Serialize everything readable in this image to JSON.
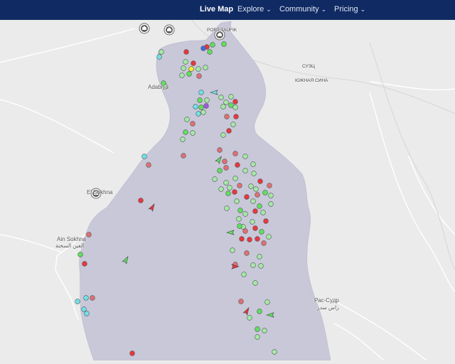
{
  "nav": {
    "live_map": "Live Map",
    "explore": "Explore",
    "community": "Community",
    "pricing": "Pricing",
    "chevron": "⌄"
  },
  "labels": {
    "port_tewfik": "PORT TAUFIK",
    "adabiya": "Adabiya",
    "el_sukhna": "El Sokhna",
    "ain_sokhna": "Ain Sokhna",
    "ain_sokhna_ar": "العين السخنة",
    "suez_ru": "СУЭЦ",
    "south_sinai_ru": "ЮЖНАЯ СИНА",
    "ras_sudr_ru": "Рас-Судр",
    "ras_sudr_ar": "راس سدر"
  },
  "colors": {
    "navbar": "#102a63",
    "water": "#c8c8d9",
    "land": "#ebebeb",
    "red": "#e8373e",
    "pink": "#df7074",
    "green": "#5ee05e",
    "lightgreen": "#a4e8a4",
    "cyan": "#6fe0e6",
    "yellow": "#f0f020",
    "purple": "#a05cd8",
    "blue": "#3c6cd9"
  },
  "icons": {
    "port": "port-icon",
    "vessel_dot": "vessel-dot-icon",
    "vessel_arrow": "vessel-arrow-icon"
  }
}
